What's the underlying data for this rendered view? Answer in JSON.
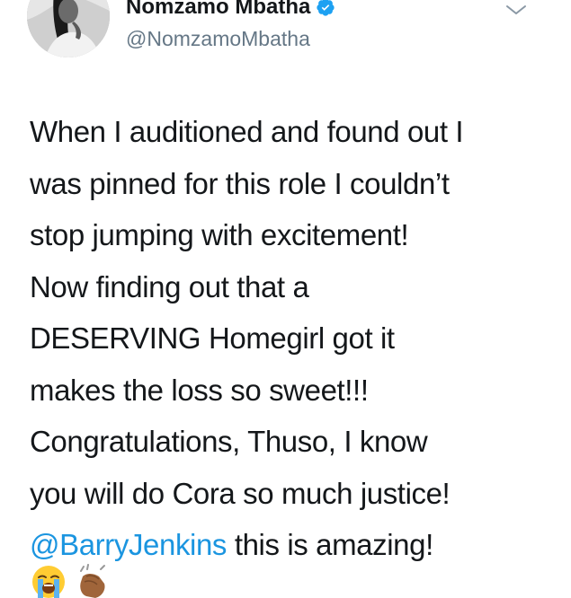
{
  "author": {
    "display_name": "Nomzamo Mbatha",
    "handle": "@NomzamoMbatha",
    "verified": true
  },
  "tweet": {
    "lines": [
      "When I auditioned and found out I",
      "was pinned for this role I couldn’t",
      "stop jumping with excitement!",
      "Now finding out that a",
      "DESERVING Homegirl got it",
      "makes the loss so sweet!!!",
      "Congratulations, Thuso, I know",
      "you will do Cora so much justice!"
    ],
    "mention": "@BarryJenkins",
    "after_mention": " this is amazing!",
    "emojis": [
      "loudly-crying-face-icon",
      "clapping-hands-icon"
    ]
  },
  "colors": {
    "link": "#1b95e0",
    "verified_badge": "#1da1f2",
    "secondary_text": "#657786",
    "primary_text": "#14171a"
  },
  "icons": {
    "menu": "chevron-down-icon",
    "badge": "verified-badge-icon"
  }
}
